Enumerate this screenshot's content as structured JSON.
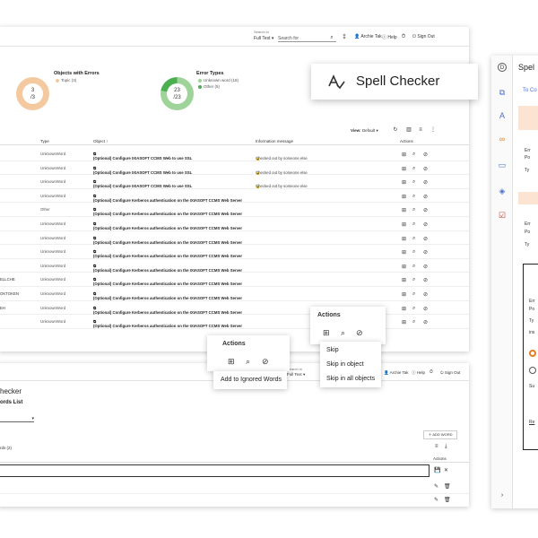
{
  "topbar": {
    "search_in_label": "Search in",
    "search_scope": "Full Text",
    "search_placeholder": "Search for",
    "user": "Archie Tak",
    "help": "Help",
    "signout": "Sign Out"
  },
  "summary": {
    "objects_title": "Objects with Errors",
    "objects_legend": "Topic (3)",
    "objects_count": "3",
    "objects_total": "/3",
    "errors_title": "Error Types",
    "errors_legend": [
      "Unknown word (18)",
      "Other (5)"
    ],
    "errors_count": "23",
    "errors_total": "/23",
    "colors": {
      "topic": "#f5c9a0",
      "unknown": "#9ed39a",
      "other": "#4caf50"
    }
  },
  "table": {
    "view_label": "View:",
    "view_value": "Default",
    "headers": {
      "type": "Type",
      "object": "Object",
      "info": "Information message",
      "actions": "Actions"
    },
    "rows": [
      {
        "prefix": "",
        "type": "UnknownWord",
        "object": "(Optional) Configure IXIASOFT CCMS Web to use SSL",
        "info": "Checked out by someone else"
      },
      {
        "prefix": "",
        "type": "UnknownWord",
        "object": "(Optional) Configure IXIASOFT CCMS Web to use SSL",
        "info": "Checked out by someone else"
      },
      {
        "prefix": "",
        "type": "UnknownWord",
        "object": "(Optional) Configure IXIASOFT CCMS Web to use SSL",
        "info": "Checked out by someone else"
      },
      {
        "prefix": "",
        "type": "UnknownWord",
        "object": "(Optional) Configure Kerberos authentication on the IXIASOFT CCMS Web Server",
        "info": ""
      },
      {
        "prefix": "",
        "type": "Other",
        "object": "(Optional) Configure Kerberos authentication on the IXIASOFT CCMS Web Server",
        "info": ""
      },
      {
        "prefix": "",
        "type": "UnknownWord",
        "object": "(Optional) Configure Kerberos authentication on the IXIASOFT CCMS Web Server",
        "info": ""
      },
      {
        "prefix": "",
        "type": "UnknownWord",
        "object": "(Optional) Configure Kerberos authentication on the IXIASOFT CCMS Web Server",
        "info": ""
      },
      {
        "prefix": "",
        "type": "UnknownWord",
        "object": "(Optional) Configure Kerberos authentication on the IXIASOFT CCMS Web Server",
        "info": ""
      },
      {
        "prefix": "",
        "type": "UnknownWord",
        "object": "(Optional) Configure Kerberos authentication on the IXIASOFT CCMS Web Server",
        "info": ""
      },
      {
        "prefix": "ELLCHE",
        "type": "UnknownWord",
        "object": "(Optional) Configure Kerberos authentication on the IXIASOFT CCMS Web Server",
        "info": ""
      },
      {
        "prefix": "OKTOKEN",
        "type": "UnknownWord",
        "object": "(Optional) Configure Kerberos authentication on the IXIASOFT CCMS Web Server",
        "info": ""
      },
      {
        "prefix": "EH",
        "type": "UnknownWord",
        "object": "(Optional) Configure Kerberos authentication on the IXIASOFT CCMS Web Server",
        "info": ""
      },
      {
        "prefix": "",
        "type": "UnknownWord",
        "object": "(Optional) Configure Kerberos authentication on the IXIASOFT CCMS Web Server",
        "info": ""
      }
    ]
  },
  "spell_card": {
    "title": "Spell Checker"
  },
  "actions_popup_left": {
    "title": "Actions",
    "menu": [
      "Add to Ignored Words"
    ]
  },
  "actions_popup_right": {
    "title": "Actions",
    "menu": [
      "Skip",
      "Skip in object",
      "Skip in all objects"
    ]
  },
  "bottom": {
    "title": "hecker",
    "subtitle": "ords List",
    "add_word": "ADD WORD",
    "count_label": "rds (2)",
    "actions": "Actions",
    "search_in": "Search in",
    "search_scope": "Full Text",
    "user": "Archie Tak",
    "help": "Help",
    "signout": "Sign Out"
  },
  "right": {
    "title": "Spel",
    "to_label": "To Co",
    "lines": [
      "Err",
      "Po",
      "Ty",
      "Err",
      "Po",
      "Ty",
      "Err",
      "Po",
      "Ty",
      "ins",
      "Su",
      "Re"
    ]
  }
}
